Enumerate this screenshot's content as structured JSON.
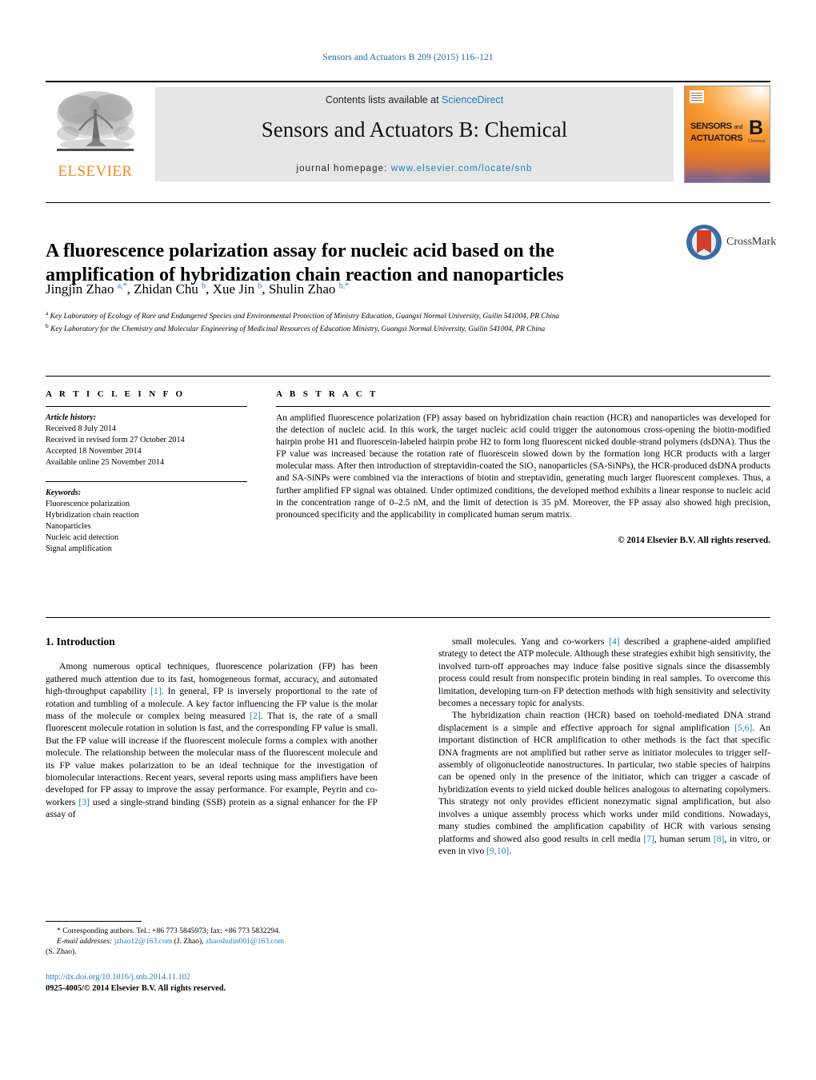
{
  "running_head": "Sensors and Actuators B 209 (2015) 116–121",
  "masthead": {
    "publisher_name": "ELSEVIER",
    "contents_prefix": "Contents lists available at ",
    "contents_link": "ScienceDirect",
    "journal_title": "Sensors and Actuators B: Chemical",
    "homepage_label": "journal homepage:",
    "homepage_url": "www.elsevier.com/locate/snb",
    "cover": {
      "line1": "SENSORS",
      "and": "and",
      "line2": "ACTUATORS",
      "letter": "B",
      "sub": "Chemical"
    }
  },
  "article": {
    "title": "A fluorescence polarization assay for nucleic acid based on the amplification of hybridization chain reaction and nanoparticles",
    "crossmark_label": "CrossMark",
    "authors_html": "Jingjin Zhao <sup>a,*</sup>, Zhidan Chu <sup>b</sup>, Xue Jin <sup>b</sup>, Shulin Zhao <sup>b,*</sup>",
    "affiliations": [
      "Key Laboratory of Ecology of Rare and Endangered Species and Environmental Protection of Ministry Education, Guangxi Normal University, Guilin 541004, PR China",
      "Key Laboratory for the Chemistry and Molecular Engineering of Medicinal Resources of Education Ministry, Guangxi Normal University, Guilin 541004, PR China"
    ],
    "affiliation_marks": [
      "a",
      "b"
    ]
  },
  "article_info": {
    "heading": "A R T I C L E  I N F O",
    "history_label": "Article history:",
    "history": [
      "Received 8 July 2014",
      "Received in revised form 27 October 2014",
      "Accepted 18 November 2014",
      "Available online 25 November 2014"
    ],
    "keywords_label": "Keywords:",
    "keywords": [
      "Fluorescence polarization",
      "Hybridization chain reaction",
      "Nanoparticles",
      "Nucleic acid detection",
      "Signal amplification"
    ]
  },
  "abstract": {
    "heading": "A B S T R A C T",
    "text": "An amplified fluorescence polarization (FP) assay based on hybridization chain reaction (HCR) and nanoparticles was developed for the detection of nucleic acid. In this work, the target nucleic acid could trigger the autonomous cross-opening the biotin-modified hairpin probe H1 and fluorescein-labeled hairpin probe H2 to form long fluorescent nicked double-strand polymers (dsDNA). Thus the FP value was increased because the rotation rate of fluorescein slowed down by the formation long HCR products with a larger molecular mass. After then introduction of streptavidin-coated the SiO₂ nanoparticles (SA-SiNPs), the HCR-produced dsDNA products and SA-SiNPs were combined via the interactions of biotin and streptavidin, generating much larger fluorescent complexes. Thus, a further amplified FP signal was obtained. Under optimized conditions, the developed method exhibits a linear response to nucleic acid in the concentration range of 0–2.5 nM, and the limit of detection is 35 pM. Moreover, the FP assay also showed high precision, pronounced specificity and the applicability in complicated human serum matrix.",
    "copyright": "© 2014 Elsevier B.V. All rights reserved."
  },
  "introduction": {
    "heading": "1. Introduction",
    "left_paragraph_1_a": "Among numerous optical techniques, fluorescence polarization (FP) has been gathered much attention due to its fast, homogeneous format, accuracy, and automated high-throughput capability ",
    "ref1": "[1]",
    "left_paragraph_1_b": ". In general, FP is inversely proportional to the rate of rotation and tumbling of a molecule. A key factor influencing the FP value is the molar mass of the molecule or complex being measured ",
    "ref2": "[2]",
    "left_paragraph_1_c": ". That is, the rate of a small fluorescent molecule rotation in solution is fast, and the corresponding FP value is small. But the FP value will increase if the fluorescent molecule forms a complex with another molecule. The relationship between the molecular mass of the fluorescent molecule and its FP value makes polarization to be an ideal technique for the investigation of biomolecular interactions. Recent years, several reports using mass amplifiers have been developed for FP assay to improve the assay performance. For example, Peyrin and co-workers ",
    "ref3": "[3]",
    "left_paragraph_1_d": " used a single-strand binding (SSB) protein as a signal enhancer for the FP assay of",
    "right_paragraph_1_a": "small molecules. Yang and co-workers ",
    "ref4": "[4]",
    "right_paragraph_1_b": " described a graphene-aided amplified strategy to detect the ATP molecule. Although these strategies exhibit high sensitivity, the involved turn-off approaches may induce false positive signals since the disassembly process could result from nonspecific protein binding in real samples. To overcome this limitation, developing turn-on FP detection methods with high sensitivity and selectivity becomes a necessary topic for analysts.",
    "right_paragraph_2_a": "The hybridization chain reaction (HCR) based on toehold-mediated DNA strand displacement is a simple and effective approach for signal amplification ",
    "ref56": "[5,6]",
    "right_paragraph_2_b": ". An important distinction of HCR amplification to other methods is the fact that specific DNA fragments are not amplified but rather serve as initiator molecules to trigger self-assembly of oligonucleotide nanostructures. In particular, two stable species of hairpins can be opened only in the presence of the initiator, which can trigger a cascade of hybridization events to yield nicked double helices analogous to alternating copolymers. This strategy not only provides efficient nonezymatic signal amplification, but also involves a unique assembly process which works under mild conditions. Nowadays, many studies combined the amplification capability of HCR with various sensing platforms and showed also good results in cell media ",
    "ref7": "[7]",
    "right_paragraph_2_c": ", human serum ",
    "ref8": "[8]",
    "right_paragraph_2_d": ", in vitro, or even in vivo ",
    "ref910": "[9,10]",
    "right_paragraph_2_e": "."
  },
  "footnotes": {
    "corresponding": "* Corresponding authors. Tel.: +86 773 5845973; fax: +86 773 5832294.",
    "email_label": "E-mail addresses:",
    "email1": "jzhao12@163.com",
    "email1_owner": " (J. Zhao),",
    "email2": "zhaoshulin001@163.com",
    "email2_owner": "(S. Zhao).",
    "doi": "http://dx.doi.org/10.1016/j.snb.2014.11.102",
    "issn_line": "0925-4005/© 2014 Elsevier B.V. All rights reserved."
  },
  "colors": {
    "link_blue": "#1a7fbf",
    "header_blue": "#1a6c9c",
    "elsevier_orange": "#f08a1c",
    "banner_gray": "#e6e6e6",
    "crossmark_red": "#d0422c",
    "crossmark_blue": "#3f6fa8"
  }
}
